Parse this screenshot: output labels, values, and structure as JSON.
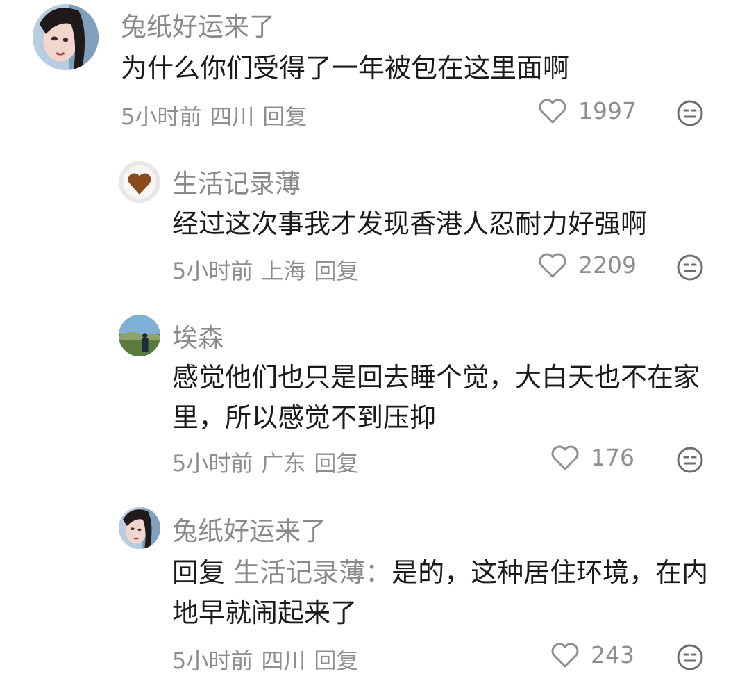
{
  "comments": [
    {
      "author": "兔纸好运来了",
      "text": "为什么你们受得了一年被包在这里面啊",
      "time": "5小时前",
      "location": "四川",
      "reply_label": "回复",
      "likes": "1997"
    },
    {
      "author": "生活记录薄",
      "text": "经过这次事我才发现香港人忍耐力好强啊",
      "time": "5小时前",
      "location": "上海",
      "reply_label": "回复",
      "likes": "2209"
    },
    {
      "author": "埃森",
      "text": "感觉他们也只是回去睡个觉，大白天也不在家里，所以感觉不到压抑",
      "time": "5小时前",
      "location": "广东",
      "reply_label": "回复",
      "likes": "176"
    },
    {
      "author": "兔纸好运来了",
      "reply_prefix": "回复",
      "reply_target": "生活记录薄：",
      "text": "是的，这种居住环境，在内地早就闹起来了",
      "time": "5小时前",
      "location": "四川",
      "reply_label": "回复",
      "likes": "243"
    }
  ],
  "icons": {
    "like": "heart-outline-icon",
    "more": "face-icon"
  },
  "colors": {
    "text": "#1a1a1a",
    "secondary": "#8e8e8e",
    "background": "#ffffff"
  }
}
